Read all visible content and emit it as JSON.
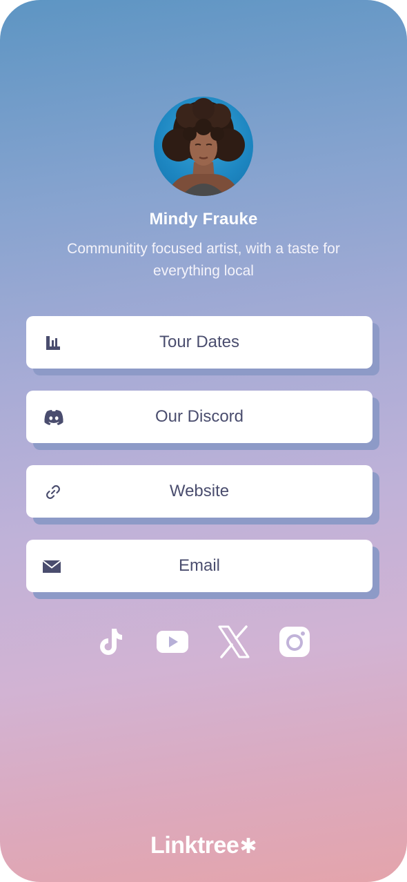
{
  "profile": {
    "name": "Mindy Frauke",
    "bio": "Communitity focused artist, with a taste for everything local"
  },
  "links": [
    {
      "label": "Tour Dates",
      "icon": "bandsintown-icon"
    },
    {
      "label": "Our Discord",
      "icon": "discord-icon"
    },
    {
      "label": "Website",
      "icon": "link-icon"
    },
    {
      "label": "Email",
      "icon": "mail-icon"
    }
  ],
  "socials": [
    {
      "icon": "tiktok-icon"
    },
    {
      "icon": "youtube-icon"
    },
    {
      "icon": "x-icon"
    },
    {
      "icon": "instagram-icon"
    }
  ],
  "brand": {
    "name": "Linktree",
    "mark": "✱"
  },
  "colors": {
    "gradient_top": "#5d95c3",
    "gradient_bottom": "#e4a4ab",
    "button_bg": "#ffffff",
    "button_shadow": "#8d9ac7",
    "button_text": "#4a4d6e"
  }
}
